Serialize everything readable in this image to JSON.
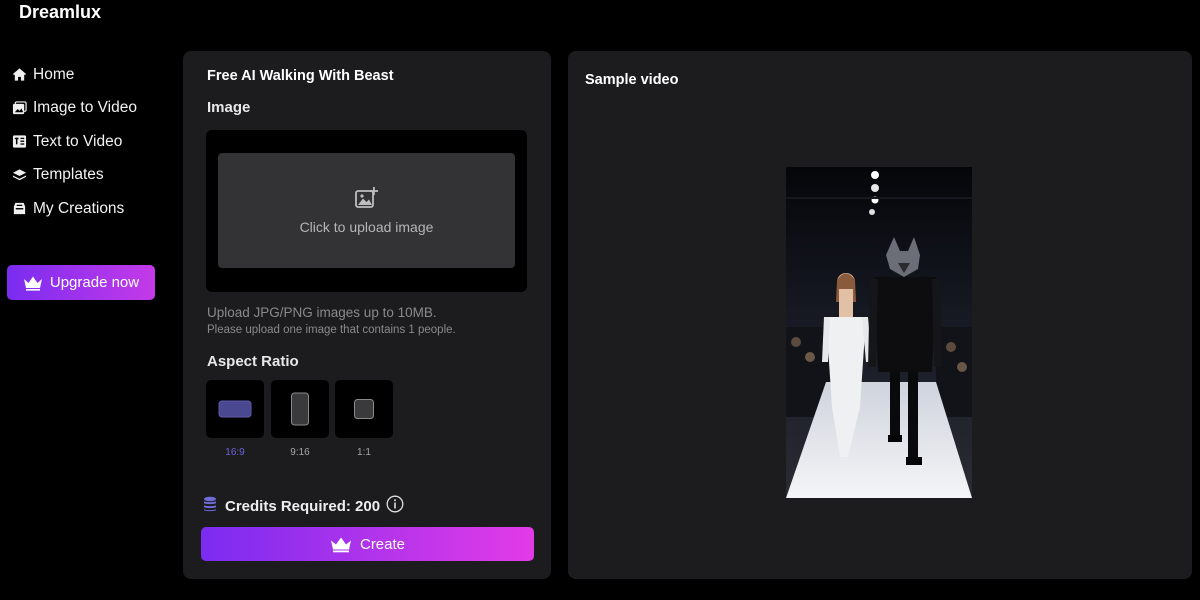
{
  "app": {
    "name": "Dreamlux"
  },
  "sidebar": {
    "items": [
      {
        "label": "Home",
        "icon": "home-icon"
      },
      {
        "label": "Image to Video",
        "icon": "image-icon"
      },
      {
        "label": "Text to Video",
        "icon": "text-video-icon"
      },
      {
        "label": "Templates",
        "icon": "layers-icon"
      },
      {
        "label": "My Creations",
        "icon": "folder-icon"
      }
    ],
    "upgrade_label": "Upgrade now"
  },
  "form": {
    "title": "Free AI Walking With Beast",
    "image_label": "Image",
    "upload_text": "Click to upload image",
    "hint_primary": "Upload JPG/PNG images up to 10MB.",
    "hint_secondary": "Please upload one image that contains 1 people.",
    "aspect_ratio_label": "Aspect Ratio",
    "aspect_options": [
      "16:9",
      "9:16",
      "1:1"
    ],
    "selected_aspect": "16:9",
    "credits_label": "Credits Required: 200",
    "create_label": "Create"
  },
  "preview": {
    "title": "Sample video"
  },
  "colors": {
    "accent_gradient_start": "#7a2cf0",
    "accent_gradient_end": "#e33be6",
    "selected_ratio": "#4a4890",
    "panel_bg": "#1c1c1f"
  }
}
